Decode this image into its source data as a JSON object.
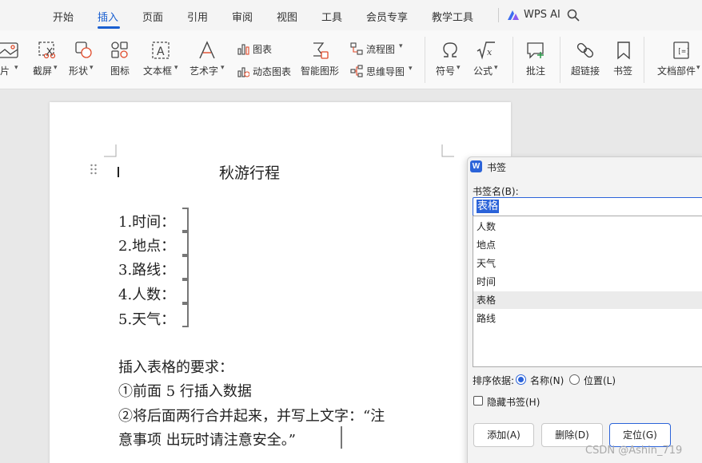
{
  "menu": {
    "tabs": [
      "开始",
      "插入",
      "页面",
      "引用",
      "审阅",
      "视图",
      "工具",
      "会员专享",
      "教学工具"
    ],
    "active_tab": "插入",
    "ai_label": "WPS AI"
  },
  "ribbon": {
    "picture": "图片",
    "screenshot": "截屏",
    "shape": "形状",
    "icon": "图标",
    "textbox": "文本框",
    "wordart": "艺术字",
    "chart": "图表",
    "dynamic_chart": "动态图表",
    "smart_graphic": "智能图形",
    "flowchart": "流程图",
    "mindmap": "思维导图",
    "symbol": "符号",
    "formula": "公式",
    "comment": "批注",
    "hyperlink": "超链接",
    "bookmark": "书签",
    "doc_parts": "文档部件"
  },
  "document": {
    "title": "秋游行程",
    "items": [
      "1.时间：",
      "2.地点：",
      "3.路线：",
      "4.人数：",
      "5.天气："
    ],
    "req_heading": "插入表格的要求：",
    "req_line1": "①前面 5 行插入数据",
    "req_line2": "②将后面两行合并起来，并写上文字：“注",
    "req_line3": "意事项  出玩时请注意安全。”"
  },
  "dialog": {
    "title": "书签",
    "name_label": "书签名(B):",
    "name_value": "表格",
    "bookmarks": [
      "人数",
      "地点",
      "天气",
      "时间",
      "表格",
      "路线"
    ],
    "selected_bookmark": "表格",
    "sort_label": "排序依据:",
    "sort_by_name": "名称(N)",
    "sort_by_position": "位置(L)",
    "hide_label": "隐藏书签(H)",
    "add_button": "添加(A)",
    "delete_button": "删除(D)",
    "goto_button": "定位(G)"
  },
  "watermark": "CSDN @Ashin_719",
  "colors": {
    "accent": "#1a5fd0",
    "dialog_blue": "#2b63d9"
  }
}
